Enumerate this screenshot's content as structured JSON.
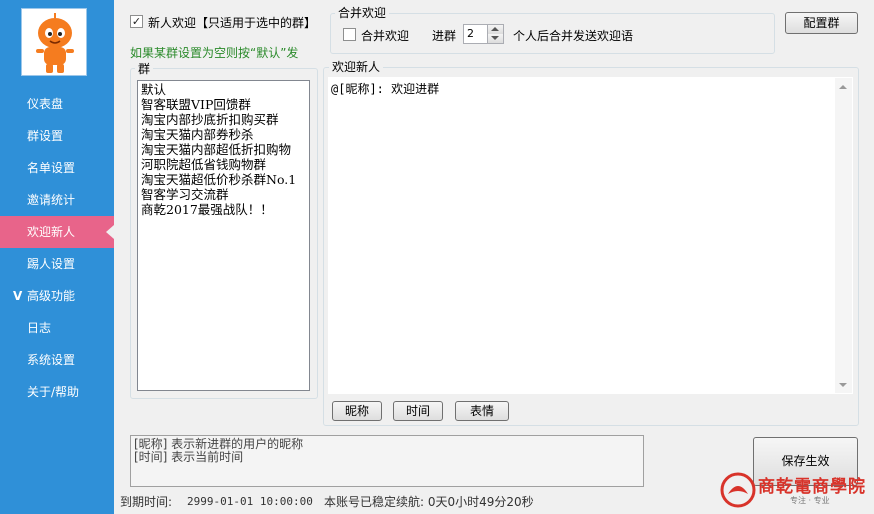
{
  "sidebar": {
    "items": [
      {
        "label": "仪表盘"
      },
      {
        "label": "群设置"
      },
      {
        "label": "名单设置"
      },
      {
        "label": "邀请统计"
      },
      {
        "label": "欢迎新人"
      },
      {
        "label": "踢人设置"
      },
      {
        "label": "高级功能"
      },
      {
        "label": "日志"
      },
      {
        "label": "系统设置"
      },
      {
        "label": "关于/帮助"
      }
    ],
    "active_index": 4,
    "expand_marker": "V",
    "color": "#2f90d8",
    "active_color": "#e8648a"
  },
  "left_panel": {
    "new_welcome_checkbox": {
      "label": "新人欢迎【只适用于选中的群】",
      "checked": true
    },
    "note": "如果某群设置为空则按“默认”发",
    "group_title": "群",
    "groups": [
      "默认",
      "智客联盟VIP回馈群",
      "淘宝内部抄底折扣购买群",
      "淘宝天猫内部券秒杀",
      "淘宝天猫内部超低折扣购物",
      "河职院超低省钱购物群",
      "淘宝天猫超低价秒杀群No.1",
      "智客学习交流群",
      "商乾2017最强战队！！"
    ]
  },
  "merge": {
    "title": "合并欢迎",
    "checkbox_label": "合并欢迎",
    "checked": false,
    "prefix": "进群",
    "count": "2",
    "suffix": "个人后合并发送欢迎语"
  },
  "config_button": "配置群",
  "welcome": {
    "title": "欢迎新人",
    "text": "@[昵称]: 欢迎进群",
    "buttons": [
      "昵称",
      "时间",
      "表情"
    ]
  },
  "hint": {
    "line1": "[昵称] 表示新进群的用户的昵称",
    "line2": "[时间] 表示当前时间"
  },
  "save_button": "保存生效",
  "status": {
    "expire_label": "到期时间:",
    "expire_value": "2999-01-01 10:00:00",
    "uptime": "本账号已稳定续航: 0天0小时49分20秒"
  },
  "logo": {
    "text": "商乾電商學院",
    "slogan": "专注 · 专业",
    "color": "#d8332a"
  }
}
